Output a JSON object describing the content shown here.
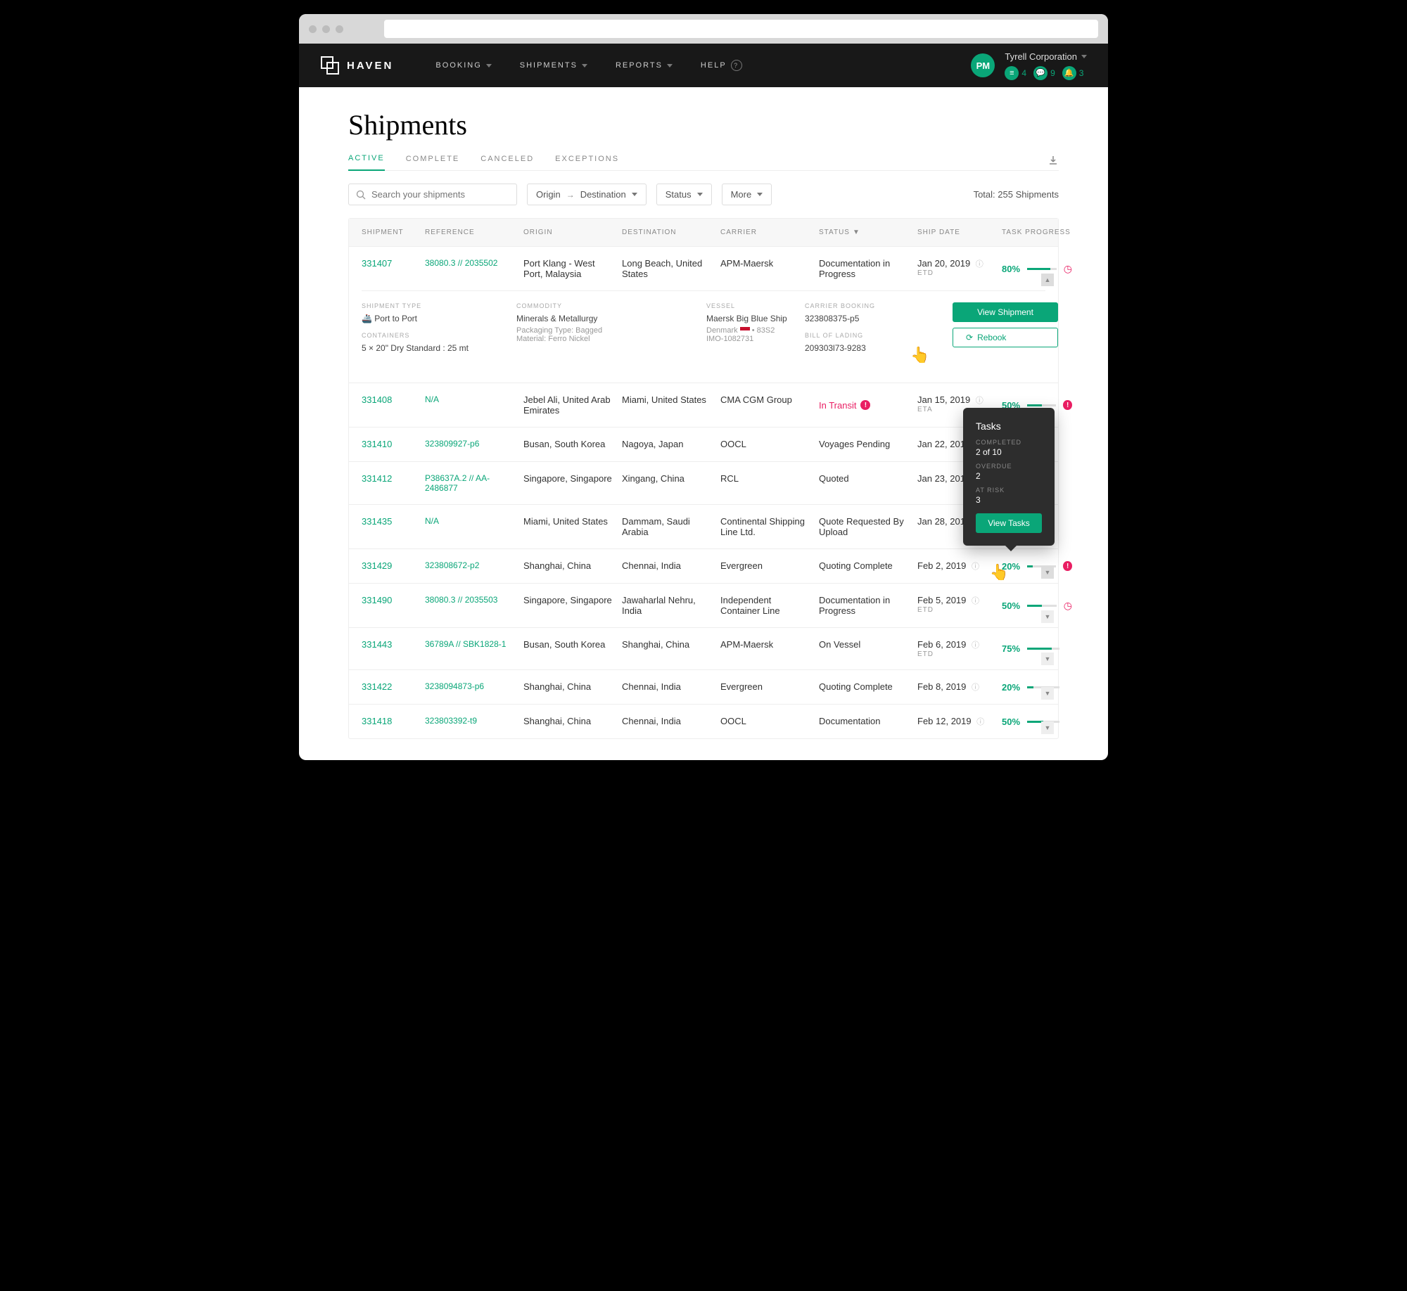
{
  "brand": "HAVEN",
  "nav": {
    "booking": "BOOKING",
    "shipments": "SHIPMENTS",
    "reports": "REPORTS",
    "help": "HELP"
  },
  "user": {
    "initials": "PM",
    "company": "Tyrell Corporation",
    "badge1": "4",
    "badge2": "9",
    "badge3": "3"
  },
  "page_title": "Shipments",
  "tabs": {
    "active": "ACTIVE",
    "complete": "COMPLETE",
    "canceled": "CANCELED",
    "exceptions": "EXCEPTIONS"
  },
  "search_placeholder": "Search your shipments",
  "filters": {
    "origin": "Origin",
    "destination": "Destination",
    "status": "Status",
    "more": "More"
  },
  "total_label": "Total:",
  "total_value": "255 Shipments",
  "columns": {
    "shipment": "SHIPMENT",
    "reference": "REFERENCE",
    "origin": "ORIGIN",
    "destination": "DESTINATION",
    "carrier": "CARRIER",
    "status": "STATUS",
    "ship_date": "SHIP DATE",
    "task_progress": "TASK PROGRESS"
  },
  "rows": [
    {
      "id": "331407",
      "ref": "38080.3 // 2035502",
      "origin": "Port Klang - West Port, Malaysia",
      "dest": "Long Beach, United States",
      "carrier": "APM-Maersk",
      "status": "Documentation in Progress",
      "date": "Jan 20, 2019",
      "date_sub": "ETD",
      "pct": "80%",
      "pctv": 80,
      "clock": true
    },
    {
      "id": "331408",
      "ref": "N/A",
      "origin": "Jebel Ali, United Arab Emirates",
      "dest": "Miami, United States",
      "carrier": "CMA CGM Group",
      "status": "In Transit",
      "transit": true,
      "date": "Jan 15, 2019",
      "date_sub": "ETA",
      "pct": "50%",
      "pctv": 50,
      "alert": true
    },
    {
      "id": "331410",
      "ref": "323809927-p6",
      "origin": "Busan, South Korea",
      "dest": "Nagoya, Japan",
      "carrier": "OOCL",
      "status": "Voyages Pending",
      "date": "Jan 22, 2019",
      "pct": "",
      "pctv": 0
    },
    {
      "id": "331412",
      "ref": "P38637A.2 // AA-2486877",
      "origin": "Singapore, Singapore",
      "dest": "Xingang, China",
      "carrier": "RCL",
      "status": "Quoted",
      "date": "Jan 23, 2019",
      "pct": "",
      "pctv": 0
    },
    {
      "id": "331435",
      "ref": "N/A",
      "origin": "Miami, United States",
      "dest": "Dammam, Saudi Arabia",
      "carrier": "Continental Shipping Line Ltd.",
      "status": "Quote Requested By Upload",
      "date": "Jan 28, 2019",
      "pct": "",
      "pctv": 0
    },
    {
      "id": "331429",
      "ref": "323808672-p2",
      "origin": "Shanghai, China",
      "dest": "Chennai, India",
      "carrier": "Evergreen",
      "status": "Quoting Complete",
      "date": "Feb 2, 2019",
      "pct": "20%",
      "pctv": 20,
      "alert": true,
      "cursor": true,
      "chev_active": true
    },
    {
      "id": "331490",
      "ref": "38080.3 // 2035503",
      "origin": "Singapore, Singapore",
      "dest": "Jawaharlal Nehru, India",
      "carrier": "Independent Container Line",
      "status": "Documentation in Progress",
      "date": "Feb 5, 2019",
      "date_sub": "ETD",
      "pct": "50%",
      "pctv": 50,
      "clock": true
    },
    {
      "id": "331443",
      "ref": "36789A // SBK1828-1",
      "origin": "Busan, South Korea",
      "dest": "Shanghai, China",
      "carrier": "APM-Maersk",
      "status": "On Vessel",
      "date": "Feb 6, 2019",
      "date_sub": "ETD",
      "pct": "75%",
      "pctv": 75
    },
    {
      "id": "331422",
      "ref": "3238094873-p6",
      "origin": "Shanghai, China",
      "dest": "Chennai, India",
      "carrier": "Evergreen",
      "status": "Quoting Complete",
      "date": "Feb 8, 2019",
      "pct": "20%",
      "pctv": 20
    },
    {
      "id": "331418",
      "ref": "323803392-t9",
      "origin": "Shanghai, China",
      "dest": "Chennai, India",
      "carrier": "OOCL",
      "status": "Documentation",
      "date": "Feb 12, 2019",
      "pct": "50%",
      "pctv": 50
    }
  ],
  "expanded": {
    "type_label": "SHIPMENT TYPE",
    "type": "Port to Port",
    "containers_label": "CONTAINERS",
    "containers": "5 × 20\" Dry Standard : 25 mt",
    "commodity_label": "COMMODITY",
    "commodity": "Minerals & Metallurgy",
    "packaging": "Packaging Type: Bagged",
    "material": "Material: Ferro Nickel",
    "vessel_label": "VESSEL",
    "vessel": "Maersk Big Blue Ship",
    "vessel_country": "Denmark",
    "vessel_code": "• 83S2",
    "imo": "IMO-1082731",
    "booking_label": "CARRIER BOOKING",
    "booking": "323808375-p5",
    "bol_label": "BILL OF LADING",
    "bol": "209303l73-9283",
    "view_btn": "View Shipment",
    "rebook_btn": "Rebook"
  },
  "tooltip": {
    "title": "Tasks",
    "completed_label": "COMPLETED",
    "completed": "2 of 10",
    "overdue_label": "OVERDUE",
    "overdue": "2",
    "atrisk_label": "AT RISK",
    "atrisk": "3",
    "button": "View Tasks"
  }
}
